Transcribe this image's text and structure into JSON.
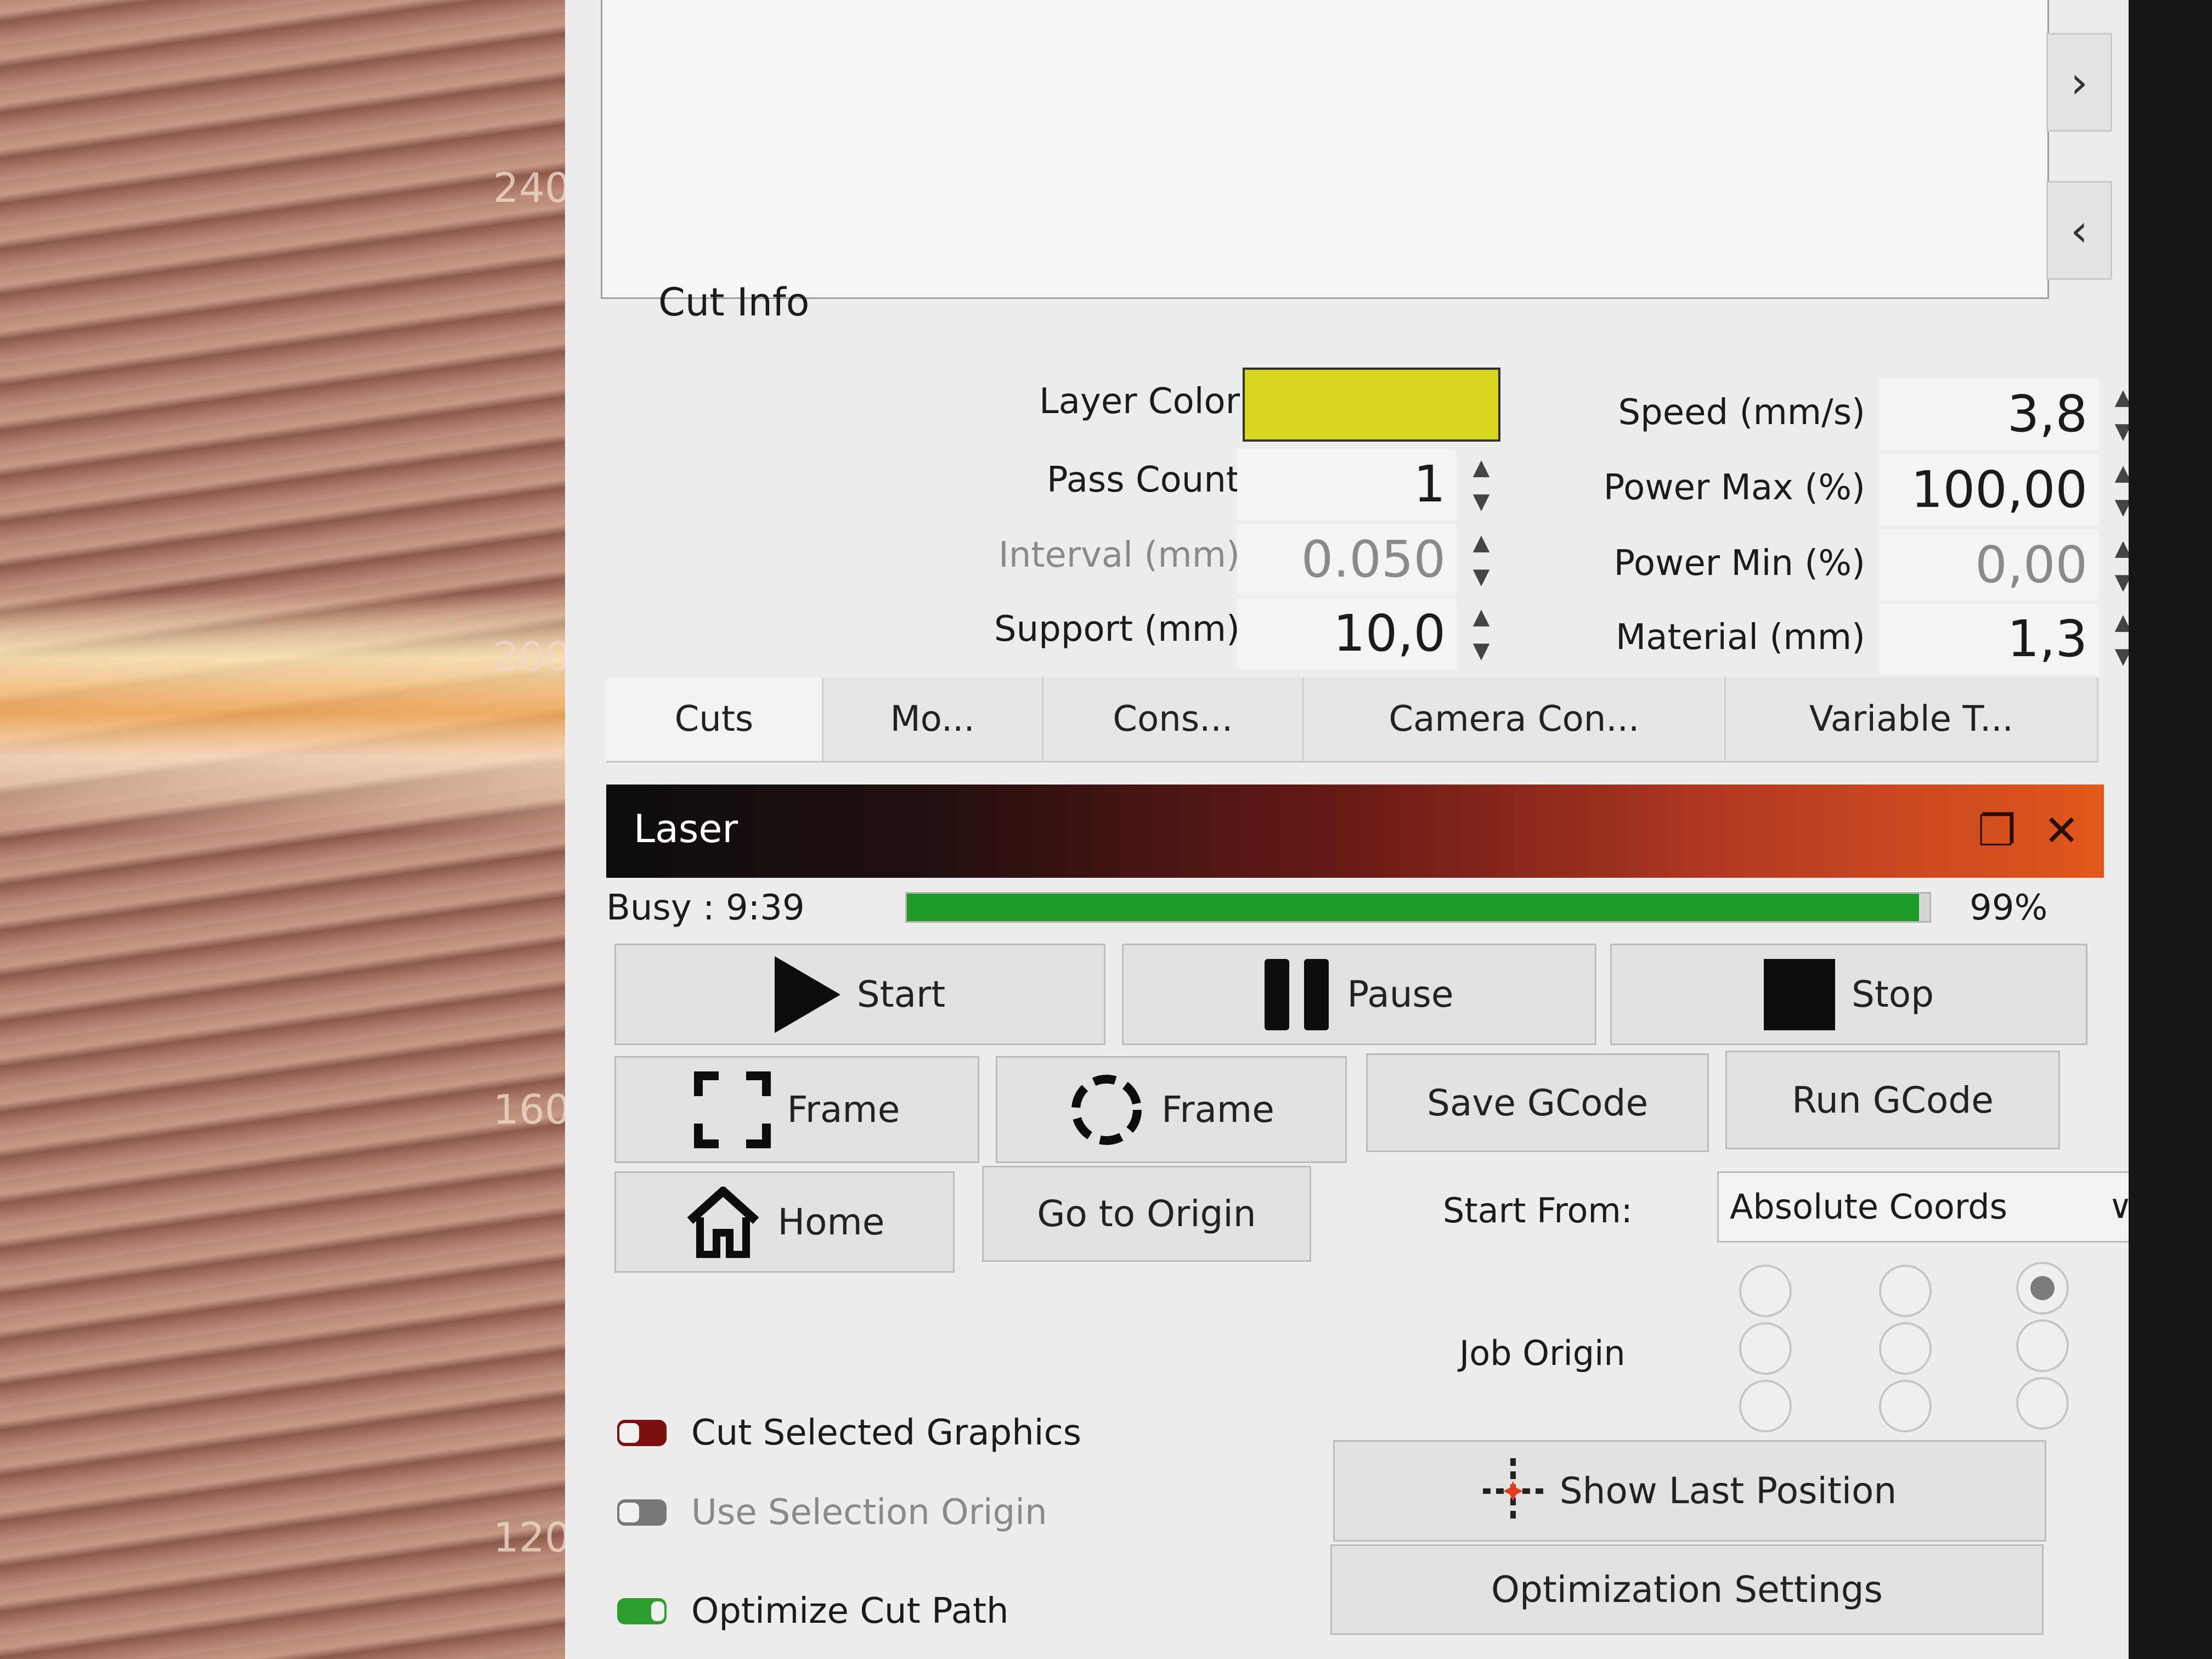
{
  "canvas": {
    "ruler_labels": [
      "240",
      "200",
      "160",
      "120"
    ]
  },
  "cut_info": {
    "title": "Cut Info",
    "layer_color": {
      "label": "Layer Color",
      "color": "#d8d71f"
    },
    "pass_count": {
      "label": "Pass Count",
      "value": "1"
    },
    "interval": {
      "label": "Interval (mm)",
      "value": "0.050"
    },
    "support": {
      "label": "Support (mm)",
      "value": "10,0"
    },
    "speed": {
      "label": "Speed (mm/s)",
      "value": "3,8"
    },
    "power_max": {
      "label": "Power Max (%)",
      "value": "100,00"
    },
    "power_min": {
      "label": "Power Min (%)",
      "value": "0,00"
    },
    "material": {
      "label": "Material (mm)",
      "value": "1,3"
    }
  },
  "tabs": [
    {
      "label": "Cuts"
    },
    {
      "label": "Mo..."
    },
    {
      "label": "Cons..."
    },
    {
      "label": "Camera Con..."
    },
    {
      "label": "Variable T..."
    }
  ],
  "laser": {
    "title": "Laser",
    "status": "Busy : 9:39",
    "progress_percent": 99,
    "progress_label": "99%",
    "buttons": {
      "start": "Start",
      "pause": "Pause",
      "stop": "Stop",
      "frame_rect": "Frame",
      "frame_circle": "Frame",
      "save_gcode": "Save GCode",
      "run_gcode": "Run GCode",
      "home": "Home",
      "go_to_origin": "Go to Origin",
      "show_last_position": "Show Last Position",
      "optimization_settings": "Optimization Settings"
    },
    "start_from": {
      "label": "Start From:",
      "value": "Absolute Coords"
    },
    "job_origin": {
      "label": "Job Origin",
      "selected": "top-right"
    },
    "toggles": {
      "cut_selected_graphics": "Cut Selected Graphics",
      "use_selection_origin": "Use Selection Origin",
      "optimize_cut_path": "Optimize Cut Path"
    }
  },
  "colors": {
    "progress_green": "#1f9c28",
    "laser_bar_end": "#e2581c"
  }
}
